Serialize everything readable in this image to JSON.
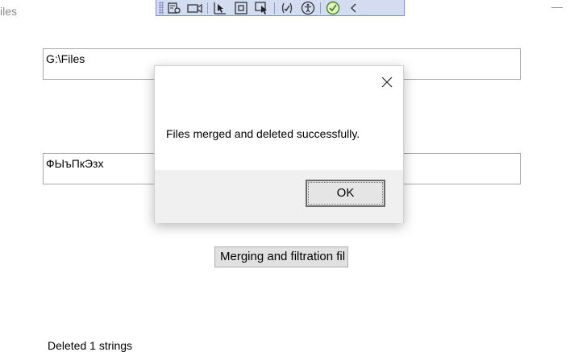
{
  "window": {
    "title": "iles",
    "minimize_glyph": "—"
  },
  "debug_toolbar": {
    "icons": [
      "select-element-icon",
      "screenshot-icon",
      "pointer-select-icon",
      "box-select-icon",
      "track-focus-icon",
      "binding-icon",
      "accessibility-icon",
      "check-icon",
      "collapse-icon"
    ]
  },
  "path_field": {
    "value": "G:\\Files"
  },
  "filter_field": {
    "value": "ФЫъПкЭзх"
  },
  "merge_button": {
    "label": "Merging and filtration fil"
  },
  "status": {
    "text": "Deleted 1 strings"
  },
  "dialog": {
    "message": "Files merged and deleted successfully.",
    "ok_label": "OK"
  }
}
